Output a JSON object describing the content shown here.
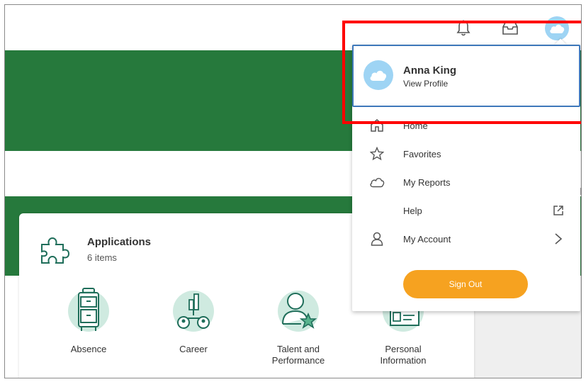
{
  "topbar": {
    "notifications_icon": "bell-icon",
    "inbox_icon": "inbox-icon",
    "profile_icon": "cloud-avatar-icon"
  },
  "applications": {
    "title": "Applications",
    "count": "6 items",
    "icon": "puzzle-icon",
    "tiles": [
      {
        "label": "Absence",
        "icon": "luggage-icon"
      },
      {
        "label": "Career",
        "icon": "career-chart-icon"
      },
      {
        "label": "Talent and Performance",
        "label_line1": "Talent and",
        "label_line2": "Performance",
        "icon": "talent-star-icon"
      },
      {
        "label": "Personal Information",
        "label_line1": "Personal",
        "label_line2": "Information",
        "icon": "id-card-icon"
      }
    ]
  },
  "menu": {
    "profile": {
      "name": "Anna King",
      "link": "View Profile",
      "avatar_icon": "cloud-avatar-icon"
    },
    "items": [
      {
        "label": "Home",
        "icon": "home-icon"
      },
      {
        "label": "Favorites",
        "icon": "star-icon"
      },
      {
        "label": "My Reports",
        "icon": "cloud-icon"
      },
      {
        "label": "Help",
        "icon": "",
        "right_icon": "external-link-icon"
      },
      {
        "label": "My Account",
        "icon": "person-icon",
        "right_icon": "chevron-right-icon"
      }
    ],
    "sign_out": "Sign Out"
  },
  "colors": {
    "brand_green": "#26793c",
    "profile_border": "#3e78ba",
    "sign_out": "#f6a220",
    "highlight": "#ff0000",
    "avatar": "#9ed4f4",
    "app_icon": "#1f6e5a",
    "app_icon_bg": "#cfeae0"
  }
}
